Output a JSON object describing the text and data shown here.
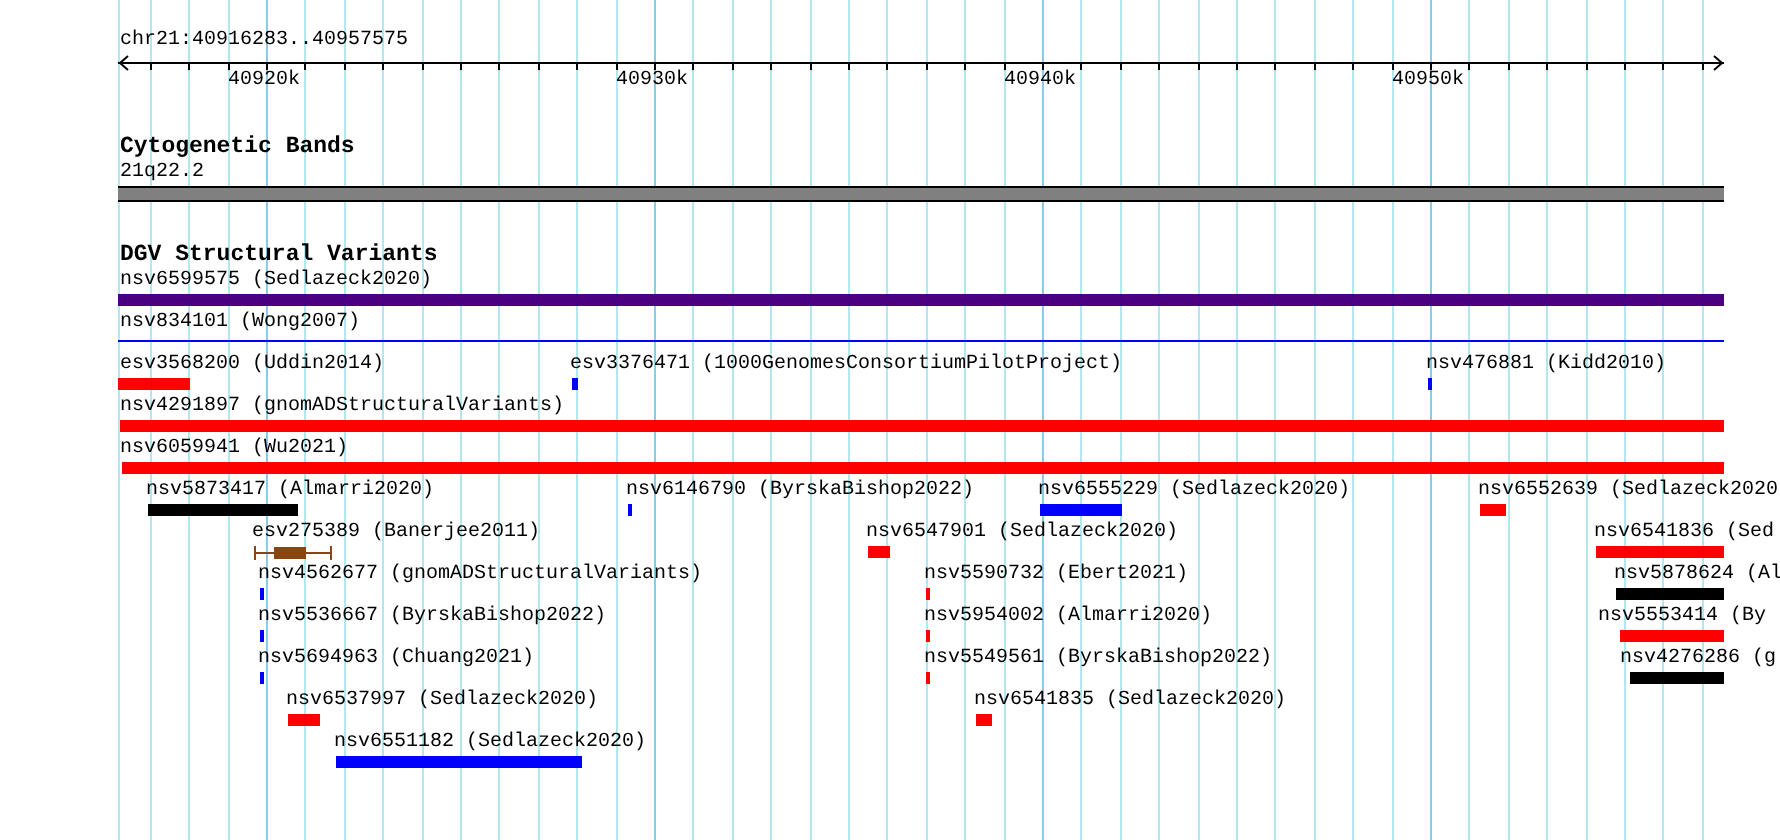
{
  "ruler": {
    "locus": "chr21:40916283..40957575",
    "ticks": [
      "40920k",
      "40930k",
      "40940k",
      "40950k"
    ]
  },
  "tracks": [
    {
      "title": "Cytogenetic Bands",
      "features": [
        {
          "label": "21q22.2",
          "kind": "band",
          "color": "#808080"
        }
      ]
    },
    {
      "title": "DGV Structural Variants",
      "features": [
        {
          "label": "nsv6599575 (Sedlazeck2020)",
          "kind": "bar",
          "color": "#4b0082"
        },
        {
          "label": "nsv834101 (Wong2007)",
          "kind": "line",
          "color": "#0000ff"
        },
        {
          "label": "esv3568200 (Uddin2014)",
          "kind": "bar",
          "color": "#ff0000"
        },
        {
          "label": "esv3376471 (1000GenomesConsortiumPilotProject)",
          "kind": "bar",
          "color": "#0000ff"
        },
        {
          "label": "nsv476881 (Kidd2010)",
          "kind": "bar",
          "color": "#0000ff"
        },
        {
          "label": "nsv4291897 (gnomADStructuralVariants)",
          "kind": "bar",
          "color": "#ff0000"
        },
        {
          "label": "nsv6059941 (Wu2021)",
          "kind": "bar",
          "color": "#ff0000"
        },
        {
          "label": "nsv5873417 (Almarri2020)",
          "kind": "bar",
          "color": "#000000"
        },
        {
          "label": "nsv6146790 (ByrskaBishop2022)",
          "kind": "bar",
          "color": "#0000ff"
        },
        {
          "label": "nsv6555229 (Sedlazeck2020)",
          "kind": "bar",
          "color": "#0000ff"
        },
        {
          "label": "nsv6552639 (Sedlazeck2020",
          "kind": "bar",
          "color": "#ff0000"
        },
        {
          "label": "esv275389 (Banerjee2011)",
          "kind": "whisker",
          "color": "#8b4513"
        },
        {
          "label": "nsv6547901 (Sedlazeck2020)",
          "kind": "bar",
          "color": "#ff0000"
        },
        {
          "label": "nsv6541836 (Sed",
          "kind": "bar",
          "color": "#ff0000"
        },
        {
          "label": "nsv4562677 (gnomADStructuralVariants)",
          "kind": "bar",
          "color": "#0000ff"
        },
        {
          "label": "nsv5590732 (Ebert2021)",
          "kind": "bar",
          "color": "#ff0000"
        },
        {
          "label": "nsv5878624 (Al",
          "kind": "bar",
          "color": "#000000"
        },
        {
          "label": "nsv5536667 (ByrskaBishop2022)",
          "kind": "bar",
          "color": "#0000ff"
        },
        {
          "label": "nsv5954002 (Almarri2020)",
          "kind": "bar",
          "color": "#ff0000"
        },
        {
          "label": "nsv5553414 (By",
          "kind": "bar",
          "color": "#ff0000"
        },
        {
          "label": "nsv5694963 (Chuang2021)",
          "kind": "bar",
          "color": "#0000ff"
        },
        {
          "label": "nsv5549561 (ByrskaBishop2022)",
          "kind": "bar",
          "color": "#ff0000"
        },
        {
          "label": "nsv4276286 (g",
          "kind": "bar",
          "color": "#000000"
        },
        {
          "label": "nsv6537997 (Sedlazeck2020)",
          "kind": "bar",
          "color": "#ff0000"
        },
        {
          "label": "nsv6541835 (Sedlazeck2020)",
          "kind": "bar",
          "color": "#ff0000"
        },
        {
          "label": "nsv6551182 (Sedlazeck2020)",
          "kind": "bar",
          "color": "#0000ff"
        }
      ]
    }
  ]
}
